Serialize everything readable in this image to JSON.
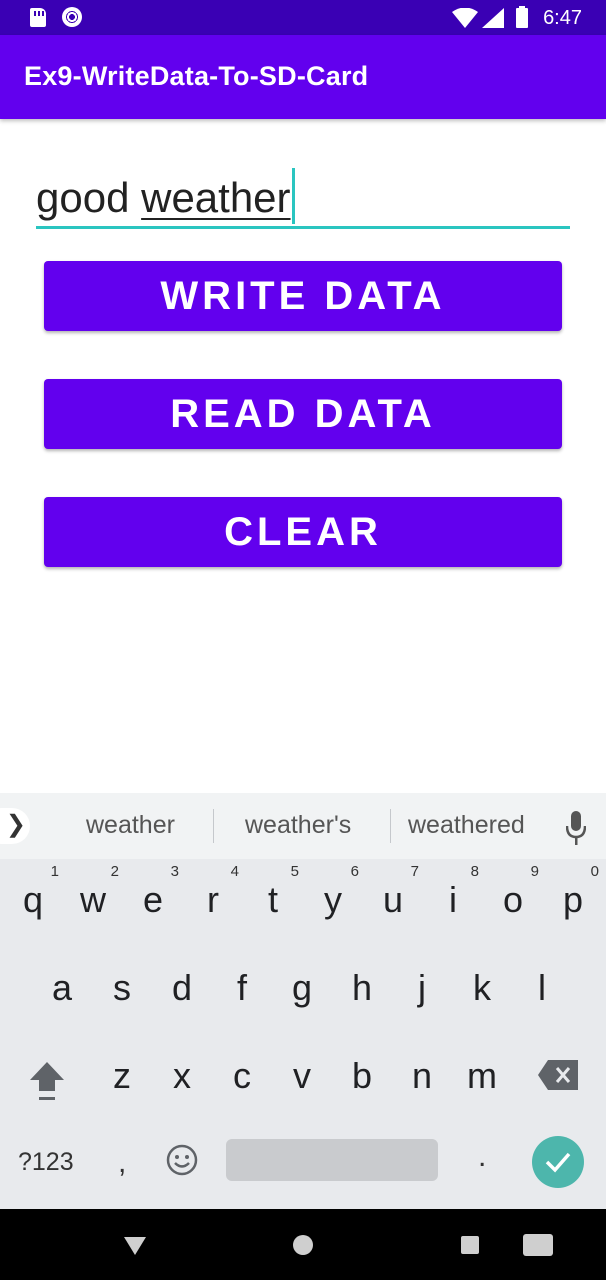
{
  "status_bar": {
    "time": "6:47",
    "icons": [
      "sd-card-icon",
      "loading-icon",
      "wifi-icon",
      "signal-icon",
      "battery-icon"
    ]
  },
  "app_bar": {
    "title": "Ex9-WriteData-To-SD-Card",
    "color": "#6200ee"
  },
  "input": {
    "text_plain": "good ",
    "text_composing": "weather",
    "underline_color": "#2ac5c0"
  },
  "buttons": {
    "write": "WRITE DATA",
    "read": "READ DATA",
    "clear": "CLEAR"
  },
  "keyboard": {
    "suggestions": [
      "weather",
      "weather's",
      "weathered"
    ],
    "row1": [
      {
        "k": "q",
        "n": "1"
      },
      {
        "k": "w",
        "n": "2"
      },
      {
        "k": "e",
        "n": "3"
      },
      {
        "k": "r",
        "n": "4"
      },
      {
        "k": "t",
        "n": "5"
      },
      {
        "k": "y",
        "n": "6"
      },
      {
        "k": "u",
        "n": "7"
      },
      {
        "k": "i",
        "n": "8"
      },
      {
        "k": "o",
        "n": "9"
      },
      {
        "k": "p",
        "n": "0"
      }
    ],
    "row2": [
      "a",
      "s",
      "d",
      "f",
      "g",
      "h",
      "j",
      "k",
      "l"
    ],
    "row3": [
      "z",
      "x",
      "c",
      "v",
      "b",
      "n",
      "m"
    ],
    "mode_label": "?123",
    "comma": ",",
    "period": ".",
    "enter_color": "#4db6ac"
  },
  "nav_bar": {
    "icons": [
      "back-icon",
      "home-icon",
      "recents-icon",
      "keyboard-switch-icon"
    ]
  }
}
